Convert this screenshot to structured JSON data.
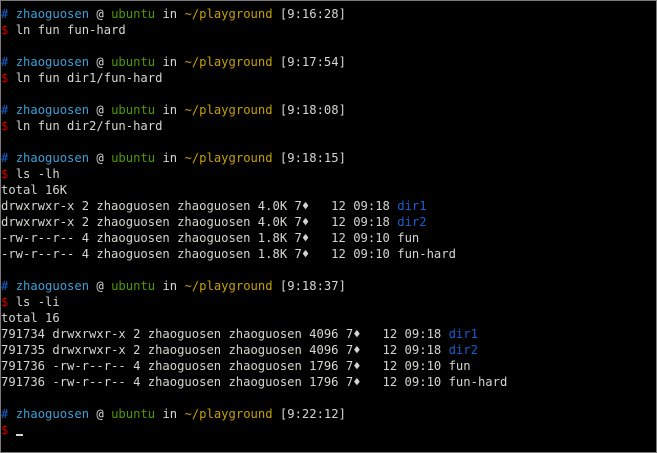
{
  "colors": {
    "background": "#000000",
    "text": "#d3d7cf",
    "hash": "#1a5fd1",
    "user": "#3a9fd6",
    "host": "#4e9a06",
    "path": "#c4a000",
    "dollar": "#cc0000",
    "dir": "#1a5fd1"
  },
  "prompt": {
    "hash": "#",
    "user": "zhaoguosen",
    "at": "@",
    "host": "ubuntu",
    "in": "in",
    "path": "~/playground",
    "dollar": "$"
  },
  "blocks": [
    {
      "time": "[9:16:28]",
      "command": "ln fun fun-hard",
      "output": []
    },
    {
      "time": "[9:17:54]",
      "command": "ln fun dir1/fun-hard",
      "output": []
    },
    {
      "time": "[9:18:08]",
      "command": "ln fun dir2/fun-hard",
      "output": []
    },
    {
      "time": "[9:18:15]",
      "command": "ls -lh",
      "output": [
        {
          "text": "total 16K",
          "name": ""
        },
        {
          "text": "drwxrwxr-x 2 zhaoguosen zhaoguosen 4.0K 7♦   12 09:18 ",
          "name": "dir1",
          "dir": true
        },
        {
          "text": "drwxrwxr-x 2 zhaoguosen zhaoguosen 4.0K 7♦   12 09:18 ",
          "name": "dir2",
          "dir": true
        },
        {
          "text": "-rw-r--r-- 4 zhaoguosen zhaoguosen 1.8K 7♦   12 09:10 ",
          "name": "fun",
          "dir": false
        },
        {
          "text": "-rw-r--r-- 4 zhaoguosen zhaoguosen 1.8K 7♦   12 09:10 ",
          "name": "fun-hard",
          "dir": false
        }
      ]
    },
    {
      "time": "[9:18:37]",
      "command": "ls -li",
      "output": [
        {
          "text": "total 16",
          "name": ""
        },
        {
          "text": "791734 drwxrwxr-x 2 zhaoguosen zhaoguosen 4096 7♦   12 09:18 ",
          "name": "dir1",
          "dir": true
        },
        {
          "text": "791735 drwxrwxr-x 2 zhaoguosen zhaoguosen 4096 7♦   12 09:18 ",
          "name": "dir2",
          "dir": true
        },
        {
          "text": "791736 -rw-r--r-- 4 zhaoguosen zhaoguosen 1796 7♦   12 09:10 ",
          "name": "fun",
          "dir": false
        },
        {
          "text": "791736 -rw-r--r-- 4 zhaoguosen zhaoguosen 1796 7♦   12 09:10 ",
          "name": "fun-hard",
          "dir": false
        }
      ]
    },
    {
      "time": "[9:22:12]",
      "command": "",
      "output": [],
      "active": true
    }
  ]
}
